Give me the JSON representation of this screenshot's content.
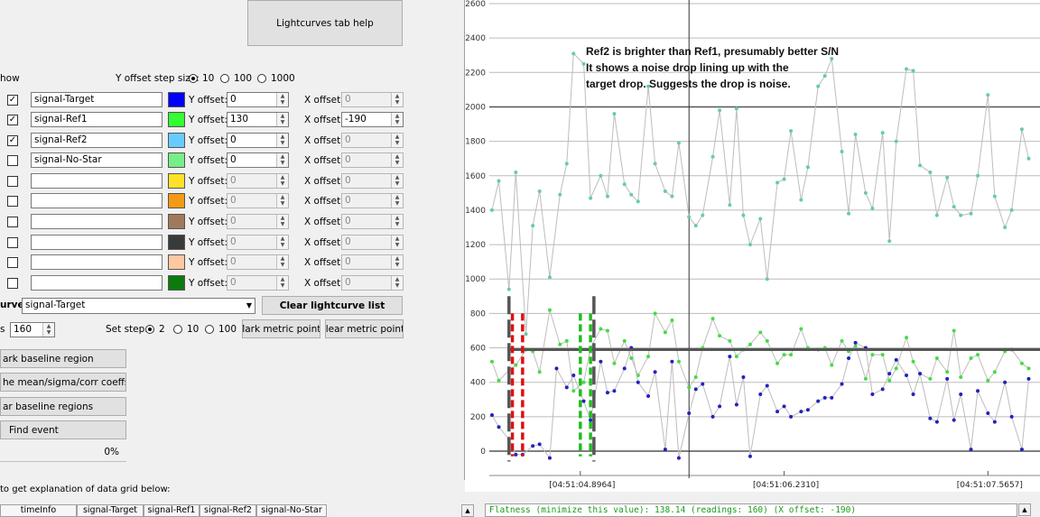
{
  "help_button": "Lightcurves tab help",
  "show_label": "how",
  "offset_step": {
    "label": "Y offset step size:",
    "options": [
      "10",
      "100",
      "1000"
    ],
    "selected": "10"
  },
  "rows": [
    {
      "checked": true,
      "name": "signal-Target",
      "color": "#0000ff",
      "y_offset": "0",
      "x_offset": "0",
      "y_enabled": true,
      "x_enabled": false
    },
    {
      "checked": true,
      "name": "signal-Ref1",
      "color": "#33ff33",
      "y_offset": "130",
      "x_offset": "-190",
      "y_enabled": true,
      "x_enabled": true
    },
    {
      "checked": true,
      "name": "signal-Ref2",
      "color": "#66ccff",
      "y_offset": "0",
      "x_offset": "0",
      "y_enabled": true,
      "x_enabled": false
    },
    {
      "checked": false,
      "name": "signal-No-Star",
      "color": "#77ee88",
      "y_offset": "0",
      "x_offset": "0",
      "y_enabled": true,
      "x_enabled": false
    },
    {
      "checked": false,
      "name": "",
      "color": "#ffe12a",
      "y_offset": "0",
      "x_offset": "0",
      "y_enabled": false,
      "x_enabled": false
    },
    {
      "checked": false,
      "name": "",
      "color": "#f59a14",
      "y_offset": "0",
      "x_offset": "0",
      "y_enabled": false,
      "x_enabled": false
    },
    {
      "checked": false,
      "name": "",
      "color": "#a07a5a",
      "y_offset": "0",
      "x_offset": "0",
      "y_enabled": false,
      "x_enabled": false
    },
    {
      "checked": false,
      "name": "",
      "color": "#3a3a3a",
      "y_offset": "0",
      "x_offset": "0",
      "y_enabled": false,
      "x_enabled": false
    },
    {
      "checked": false,
      "name": "",
      "color": "#ffc8a0",
      "y_offset": "0",
      "x_offset": "0",
      "y_enabled": false,
      "x_enabled": false
    },
    {
      "checked": false,
      "name": "",
      "color": "#0d7a0d",
      "y_offset": "0",
      "x_offset": "0",
      "y_enabled": false,
      "x_enabled": false
    }
  ],
  "y_offset_label": "Y offset:",
  "x_offset_label": "X offset:",
  "curve": {
    "label": "urve",
    "value": "signal-Target"
  },
  "clear_lightcurve_list": "Clear lightcurve list",
  "points": {
    "label": "s",
    "value": "160"
  },
  "set_step": {
    "label": "Set step:",
    "options": [
      "2",
      "10",
      "100"
    ],
    "selected": "2"
  },
  "mark_metric_points": "Mark metric points",
  "clear_metric_points": "Clear metric points",
  "mark_baseline_region": "ark baseline region",
  "mean_sigma_button": "he mean/sigma/corr coeffs",
  "clear_baseline_regions": "ar baseline regions",
  "find_event": "Find event",
  "progress": {
    "value": 0,
    "text": "0%"
  },
  "explanation_text": "to get explanation of data grid below:",
  "grid_headers": [
    "timeInfo",
    "signal-Target",
    "signal-Ref1",
    "signal-Ref2",
    "signal-No-Star"
  ],
  "status_text": "Flatness (minimize this value): 138.14 (readings: 160) (X offset: -190)",
  "chart_data": {
    "type": "scatter",
    "annotation": [
      "Ref2 is brighter than Ref1, presumably better S/N",
      "It shows a noise drop lining up with the",
      "target drop. Suggests the drop is noise."
    ],
    "ylim": [
      -100,
      2600
    ],
    "yticks": [
      0,
      200,
      400,
      600,
      800,
      1000,
      1200,
      1400,
      1600,
      1800,
      2000,
      2200,
      2400,
      2600
    ],
    "xtick_labels": [
      "[04:51:04.8964]",
      "[04:51:06.2310]",
      "[04:51:07.5657]"
    ],
    "xticks": [
      26,
      86,
      146
    ],
    "xlim": [
      0,
      160
    ],
    "cursor_x": 58,
    "baseline_y": 590,
    "red_markers": [
      6,
      9
    ],
    "grey_markers": [
      5,
      30
    ],
    "green_markers": [
      26,
      29
    ],
    "series": [
      {
        "name": "signal-Ref2",
        "color": "#66ccaa",
        "x": [
          0,
          2,
          5,
          7,
          10,
          12,
          14,
          17,
          20,
          22,
          24,
          27,
          29,
          32,
          34,
          36,
          39,
          41,
          43,
          46,
          48,
          51,
          53,
          55,
          58,
          60,
          62,
          65,
          67,
          70,
          72,
          74,
          76,
          79,
          81,
          84,
          86,
          88,
          91,
          93,
          96,
          98,
          100,
          103,
          105,
          107,
          110,
          112,
          115,
          117,
          119,
          122,
          124,
          126,
          129,
          131,
          134,
          136,
          138,
          141,
          143,
          146,
          148,
          151,
          153,
          156,
          158
        ],
        "y": [
          1400,
          1570,
          940,
          1620,
          680,
          1310,
          1510,
          1010,
          1490,
          1670,
          2310,
          2250,
          1470,
          1600,
          1480,
          1960,
          1550,
          1490,
          1450,
          2120,
          1670,
          1510,
          1480,
          1790,
          1360,
          1310,
          1370,
          1710,
          1980,
          1430,
          1990,
          1370,
          1200,
          1350,
          1000,
          1560,
          1580,
          1860,
          1460,
          1650,
          2120,
          2180,
          2280,
          1740,
          1380,
          1840,
          1500,
          1410,
          1850,
          1220,
          1800,
          2220,
          2210,
          1660,
          1620,
          1370,
          1590,
          1420,
          1370,
          1380,
          1600,
          2070,
          1480,
          1300,
          1400,
          1870,
          1700
        ]
      },
      {
        "name": "signal-Ref1",
        "color": "#44dd44",
        "x": [
          0,
          2,
          5,
          7,
          10,
          12,
          14,
          17,
          20,
          22,
          24,
          27,
          29,
          32,
          34,
          36,
          39,
          41,
          43,
          46,
          48,
          51,
          53,
          55,
          58,
          60,
          62,
          65,
          67,
          70,
          72,
          74,
          76,
          79,
          81,
          84,
          86,
          88,
          91,
          93,
          96,
          98,
          100,
          103,
          105,
          107,
          110,
          112,
          115,
          117,
          119,
          122,
          124,
          126,
          129,
          131,
          134,
          136,
          138,
          141,
          143,
          146,
          148,
          151,
          153,
          156,
          158
        ],
        "y": [
          520,
          410,
          470,
          500,
          590,
          580,
          460,
          820,
          620,
          640,
          350,
          400,
          600,
          710,
          700,
          510,
          640,
          540,
          440,
          550,
          800,
          690,
          760,
          520,
          370,
          430,
          600,
          770,
          670,
          640,
          550,
          590,
          620,
          690,
          640,
          510,
          560,
          560,
          710,
          600,
          590,
          600,
          500,
          640,
          580,
          610,
          420,
          560,
          560,
          410,
          480,
          660,
          520,
          450,
          420,
          540,
          460,
          700,
          430,
          540,
          560,
          410,
          460,
          580,
          590,
          510,
          480
        ]
      },
      {
        "name": "signal-Target",
        "color": "#2222bb",
        "x": [
          0,
          2,
          5,
          7,
          9,
          12,
          14,
          17,
          19,
          22,
          24,
          27,
          29,
          32,
          34,
          36,
          39,
          41,
          43,
          46,
          48,
          51,
          53,
          55,
          58,
          60,
          62,
          65,
          67,
          70,
          72,
          74,
          76,
          79,
          81,
          84,
          86,
          88,
          91,
          93,
          96,
          98,
          100,
          103,
          105,
          107,
          110,
          112,
          115,
          117,
          119,
          122,
          124,
          126,
          129,
          131,
          134,
          136,
          138,
          141,
          143,
          146,
          148,
          151,
          153,
          156,
          158
        ],
        "y": [
          210,
          140,
          70,
          -20,
          -20,
          30,
          40,
          -40,
          480,
          370,
          440,
          290,
          180,
          520,
          340,
          350,
          480,
          600,
          400,
          320,
          460,
          10,
          520,
          -40,
          220,
          360,
          390,
          200,
          260,
          550,
          270,
          430,
          -30,
          330,
          380,
          230,
          260,
          200,
          230,
          240,
          290,
          310,
          310,
          390,
          540,
          630,
          600,
          330,
          360,
          450,
          530,
          440,
          330,
          450,
          190,
          170,
          420,
          180,
          330,
          10,
          350,
          220,
          170,
          400,
          200,
          10,
          420
        ]
      }
    ]
  }
}
